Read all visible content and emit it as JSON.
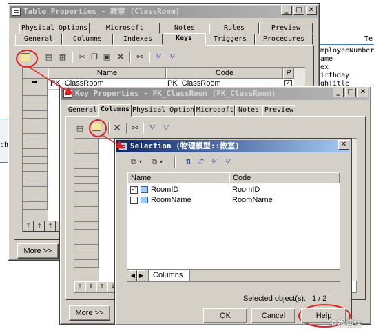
{
  "bg": {
    "right_title": "Te",
    "right_items": [
      "mployeeNumber",
      "ame",
      "ex",
      "irthday",
      "ghTitle"
    ],
    "left_fragment": "cha"
  },
  "table_props": {
    "title": "Table Properties - 教室 (ClassRoom)",
    "tabs_row1": [
      "Physical Options",
      "Microsoft",
      "Notes",
      "Rules",
      "Preview"
    ],
    "tabs_row2": [
      "General",
      "Columns",
      "Indexes",
      "Keys",
      "Triggers",
      "Procedures"
    ],
    "selected_tab": "Keys",
    "columns": [
      "Name",
      "Code",
      "P"
    ],
    "row": {
      "name": "PK_ClassRoom",
      "code": "PK_ClassRoom",
      "primary": true
    },
    "more_button": "More >>"
  },
  "key_props": {
    "title": "Key Properties - PK_ClassRoom (PK_ClassRoom)",
    "tabs": [
      "General",
      "Columns",
      "Physical Options",
      "Microsoft",
      "Notes",
      "Preview"
    ],
    "selected_tab": "Columns",
    "more_button": "More >>"
  },
  "selection": {
    "title": "Selection (物理模型::教室)",
    "columns": [
      "Name",
      "Code"
    ],
    "rows": [
      {
        "name": "RoomID",
        "code": "RoomID",
        "checked": true
      },
      {
        "name": "RoomName",
        "code": "RoomName",
        "checked": false
      }
    ],
    "tab": "Columns",
    "status_label": "Selected object(s):",
    "status_value": "1 / 2",
    "buttons": {
      "ok": "OK",
      "cancel": "Cancel",
      "help": "Help"
    }
  },
  "watermark": "©猴蓝居",
  "colors": {
    "title_active": "#0a246a",
    "annotation": "#e02020",
    "face": "#d4d0c8"
  }
}
